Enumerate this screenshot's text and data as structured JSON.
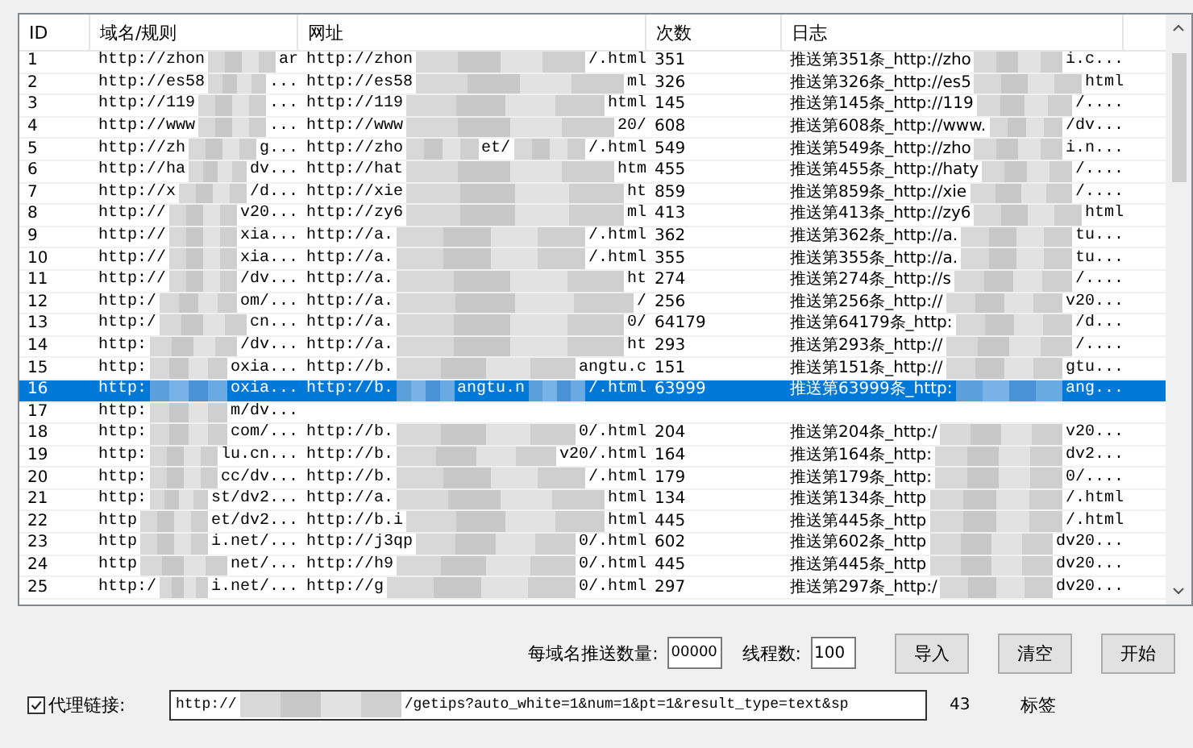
{
  "table": {
    "columns": [
      "ID",
      "域名/规则",
      "网址",
      "次数",
      "日志"
    ],
    "rows": [
      {
        "id": "1",
        "domain": [
          "http://zhon",
          "ar"
        ],
        "url": [
          "http://zhon",
          "/.html"
        ],
        "count": "351",
        "log": [
          "推送第351条_http://zho",
          "i.c..."
        ],
        "selected": false
      },
      {
        "id": "2",
        "domain": [
          "http://es58",
          "..."
        ],
        "url": [
          "http://es58",
          "ml"
        ],
        "count": "326",
        "log": [
          "推送第326条_http://es5",
          "html"
        ],
        "selected": false
      },
      {
        "id": "3",
        "domain": [
          "http://119",
          "..."
        ],
        "url": [
          "http://119",
          "html"
        ],
        "count": "145",
        "log": [
          "推送第145条_http://119",
          "/...."
        ],
        "selected": false
      },
      {
        "id": "4",
        "domain": [
          "http://www",
          "..."
        ],
        "url": [
          "http://www",
          "20/"
        ],
        "count": "608",
        "log": [
          "推送第608条_http://www.",
          "/dv..."
        ],
        "selected": false
      },
      {
        "id": "5",
        "domain": [
          "http://zh",
          "g..."
        ],
        "url": [
          "http://zho",
          "et/",
          "/.html"
        ],
        "count": "549",
        "log": [
          "推送第549条_http://zho",
          "i.n..."
        ],
        "selected": false
      },
      {
        "id": "6",
        "domain": [
          "http://ha",
          "dv..."
        ],
        "url": [
          "http://hat",
          "htm"
        ],
        "count": "455",
        "log": [
          "推送第455条_http://haty",
          "/...."
        ],
        "selected": false
      },
      {
        "id": "7",
        "domain": [
          "http://x",
          "/d..."
        ],
        "url": [
          "http://xie",
          "ht"
        ],
        "count": "859",
        "log": [
          "推送第859条_http://xie",
          "/...."
        ],
        "selected": false
      },
      {
        "id": "8",
        "domain": [
          "http://",
          "v20..."
        ],
        "url": [
          "http://zy6",
          "ml"
        ],
        "count": "413",
        "log": [
          "推送第413条_http://zy6",
          "html"
        ],
        "selected": false
      },
      {
        "id": "9",
        "domain": [
          "http://",
          "xia..."
        ],
        "url": [
          "http://a.",
          "/.html"
        ],
        "count": "362",
        "log": [
          "推送第362条_http://a.",
          "tu..."
        ],
        "selected": false
      },
      {
        "id": "10",
        "domain": [
          "http://",
          "xia..."
        ],
        "url": [
          "http://a.",
          "/.html"
        ],
        "count": "355",
        "log": [
          "推送第355条_http://a.",
          "tu..."
        ],
        "selected": false
      },
      {
        "id": "11",
        "domain": [
          "http://",
          "/dv..."
        ],
        "url": [
          "http://a.",
          "ht"
        ],
        "count": "274",
        "log": [
          "推送第274条_http://s",
          "/...."
        ],
        "selected": false
      },
      {
        "id": "12",
        "domain": [
          "http:/",
          "om/..."
        ],
        "url": [
          "http://a.",
          "/"
        ],
        "count": "256",
        "log": [
          "推送第256条_http://",
          "v20..."
        ],
        "selected": false
      },
      {
        "id": "13",
        "domain": [
          "http:/",
          "cn..."
        ],
        "url": [
          "http://a.",
          "0/"
        ],
        "count": "64179",
        "log": [
          "推送第64179条_http:",
          "/d..."
        ],
        "selected": false
      },
      {
        "id": "14",
        "domain": [
          "http:",
          "/dv..."
        ],
        "url": [
          "http://a.",
          "ht"
        ],
        "count": "293",
        "log": [
          "推送第293条_http://",
          "/...."
        ],
        "selected": false
      },
      {
        "id": "15",
        "domain": [
          "http:",
          "oxia..."
        ],
        "url": [
          "http://b.",
          "angtu.c"
        ],
        "count": "151",
        "log": [
          "推送第151条_http://",
          "gtu..."
        ],
        "selected": false
      },
      {
        "id": "16",
        "domain": [
          "http:",
          "oxia..."
        ],
        "url": [
          "http://b.",
          "angtu.n",
          "/.html"
        ],
        "count": "63999",
        "log": [
          "推送第63999条_http:",
          "ang..."
        ],
        "selected": true
      },
      {
        "id": "17",
        "domain": [
          "http:",
          "m/dv..."
        ],
        "url": [],
        "count": "",
        "log": [],
        "selected": false
      },
      {
        "id": "18",
        "domain": [
          "http:",
          "com/..."
        ],
        "url": [
          "http://b.",
          "0/.html"
        ],
        "count": "204",
        "log": [
          "推送第204条_http:/",
          "v20..."
        ],
        "selected": false
      },
      {
        "id": "19",
        "domain": [
          "http:",
          "lu.cn..."
        ],
        "url": [
          "http://b.",
          "v20/.html"
        ],
        "count": "164",
        "log": [
          "推送第164条_http:",
          "dv2..."
        ],
        "selected": false
      },
      {
        "id": "20",
        "domain": [
          "http:",
          "cc/dv..."
        ],
        "url": [
          "http://b.",
          "/.html"
        ],
        "count": "179",
        "log": [
          "推送第179条_http:",
          "0/...."
        ],
        "selected": false
      },
      {
        "id": "21",
        "domain": [
          "http:",
          "st/dv2..."
        ],
        "url": [
          "http://a.",
          "html"
        ],
        "count": "134",
        "log": [
          "推送第134条_http",
          "/.html"
        ],
        "selected": false
      },
      {
        "id": "22",
        "domain": [
          "http",
          "et/dv2..."
        ],
        "url": [
          "http://b.i",
          "html"
        ],
        "count": "445",
        "log": [
          "推送第445条_http",
          "/.html"
        ],
        "selected": false
      },
      {
        "id": "23",
        "domain": [
          "http",
          "i.net/..."
        ],
        "url": [
          "http://j3qp",
          "0/.html"
        ],
        "count": "602",
        "log": [
          "推送第602条_http",
          "dv20..."
        ],
        "selected": false
      },
      {
        "id": "24",
        "domain": [
          "http",
          "net/..."
        ],
        "url": [
          "http://h9",
          "0/.html"
        ],
        "count": "445",
        "log": [
          "推送第445条_http",
          "dv20..."
        ],
        "selected": false
      },
      {
        "id": "25",
        "domain": [
          "http:/",
          "i.net/..."
        ],
        "url": [
          "http://g",
          "0/.html"
        ],
        "count": "297",
        "log": [
          "推送第297条_http:/",
          "dv20..."
        ],
        "selected": false
      }
    ]
  },
  "controls": {
    "per_domain_label": "每域名推送数量:",
    "per_domain_value": "00000",
    "threads_label": "线程数:",
    "threads_value": "100",
    "buttons": [
      "导入",
      "清空",
      "开始"
    ]
  },
  "proxy": {
    "checked": true,
    "label": "代理链接:",
    "value": [
      "http://",
      "/getips?auto_white=1&num=1&pt=1&result_type=text&sp"
    ],
    "count": "43",
    "tag_label": "标签"
  }
}
